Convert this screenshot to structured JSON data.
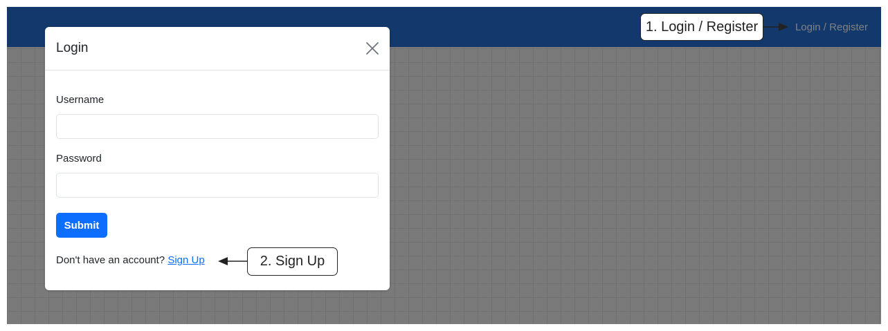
{
  "navbar": {
    "link_label": "Login / Register",
    "color": "#2772d8"
  },
  "modal": {
    "title": "Login",
    "close_icon": "close-icon",
    "username_label": "Username",
    "username_value": "",
    "password_label": "Password",
    "password_value": "",
    "submit_label": "Submit",
    "signup_prompt": "Don't have an account?",
    "signup_link": "Sign Up"
  },
  "annotations": {
    "callout_1": "1. Login / Register",
    "callout_2": "2. Sign Up"
  },
  "colors": {
    "primary": "#0d6efd",
    "overlay": "rgba(0,0,0,0.5)"
  }
}
